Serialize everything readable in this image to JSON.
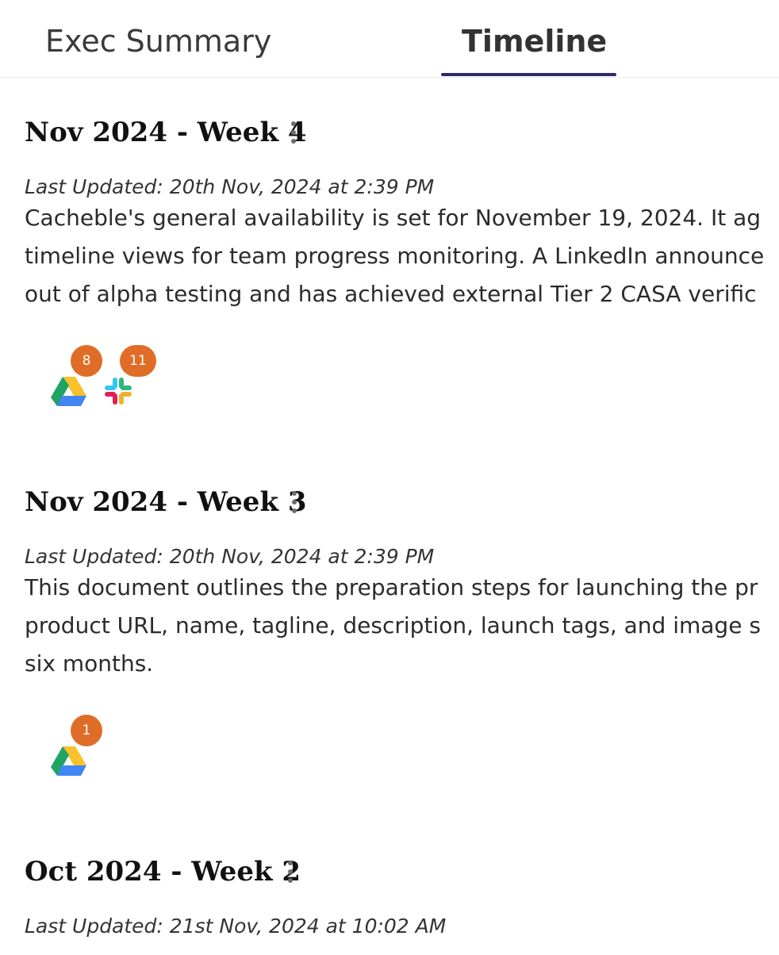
{
  "tabs": [
    {
      "label": "Exec Summary",
      "active": false
    },
    {
      "label": "Timeline",
      "active": true
    }
  ],
  "accent_color": "#2e2a6e",
  "badge_color": "#e06d27",
  "entries": [
    {
      "title": "Nov 2024 - Week 4",
      "last_updated": "Last Updated: 20th Nov, 2024 at 2:39 PM",
      "description_lines": [
        "Cacheble's general availability is set for November 19, 2024. It ag",
        "timeline views for team progress monitoring. A LinkedIn announce",
        "out of alpha testing and has achieved external Tier 2 CASA verific"
      ],
      "sources": [
        {
          "icon": "google-drive-icon",
          "count": "8"
        },
        {
          "icon": "slack-icon",
          "count": "11"
        }
      ]
    },
    {
      "title": "Nov 2024 - Week 3",
      "last_updated": "Last Updated: 20th Nov, 2024 at 2:39 PM",
      "description_lines": [
        "This document outlines the preparation steps for launching the pr",
        "product URL, name, tagline, description, launch tags, and image s",
        "six months."
      ],
      "sources": [
        {
          "icon": "google-drive-icon",
          "count": "1"
        }
      ]
    },
    {
      "title": "Oct 2024 - Week 2",
      "last_updated": "Last Updated: 21st Nov, 2024 at 10:02 AM",
      "description_lines": [],
      "sources": []
    }
  ]
}
